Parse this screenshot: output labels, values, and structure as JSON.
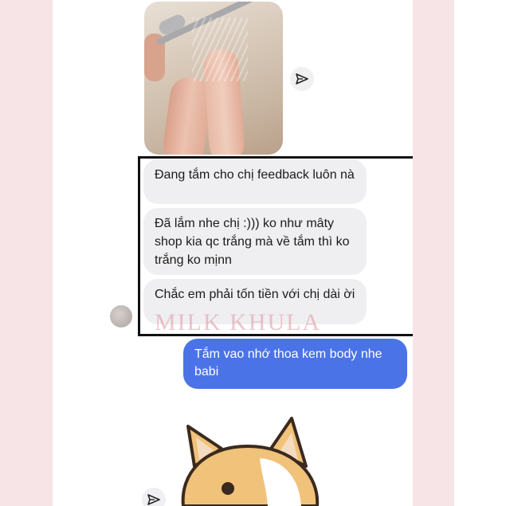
{
  "conversation": {
    "incoming_messages": [
      "Đang tắm cho chị feedback luôn nà",
      "Đã lắm nhe chị :))) ko như mâty shop kia qc trắng mà về tắm thì ko trắng ko mịnn",
      "Chắc em phải tốn tiền với chị dài ời"
    ],
    "outgoing_message": "Tắm vao nhớ thoa kem body nhe babi",
    "watermark": "MILK KHULA"
  },
  "icons": {
    "share": "paper-plane-icon",
    "avatar": "contact-avatar",
    "sticker": "cat-sticker"
  },
  "colors": {
    "incoming_bubble": "#efeff1",
    "outgoing_bubble": "#4b73e8",
    "side_panel": "#f7e4e6",
    "highlight_border": "#111111"
  }
}
